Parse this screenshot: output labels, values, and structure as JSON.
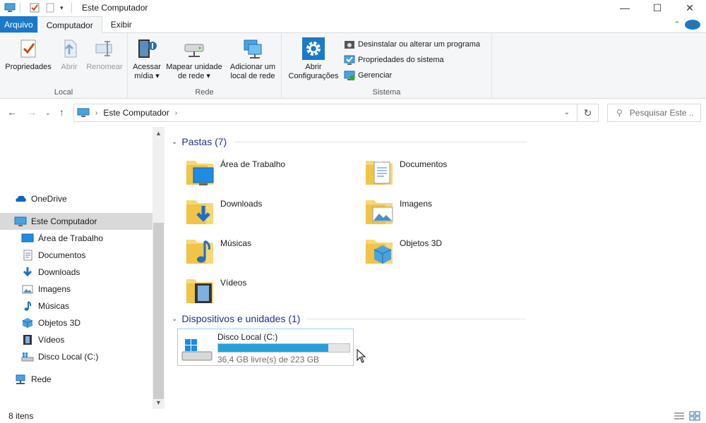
{
  "window": {
    "title": "Este Computador",
    "min_glyph": "—",
    "max_glyph": "☐",
    "close_glyph": "✕"
  },
  "tabs": {
    "file": "Arquivo",
    "computer": "Computador",
    "view": "Exibir"
  },
  "ribbon": {
    "groups": {
      "local": "Local",
      "network": "Rede",
      "system": "Sistema"
    },
    "properties": "Propriedades",
    "open": "Abrir",
    "rename": "Renomear",
    "access_media_1": "Acessar",
    "access_media_2": "mídia ▾",
    "map_drive_1": "Mapear unidade",
    "map_drive_2": "de rede ▾",
    "add_location_1": "Adicionar um",
    "add_location_2": "local de rede",
    "open_settings_1": "Abrir",
    "open_settings_2": "Configurações",
    "uninstall": "Desinstalar ou alterar um programa",
    "system_properties": "Propriedades do sistema",
    "manage": "Gerenciar"
  },
  "address": {
    "crumb": "Este Computador",
    "search_placeholder": "Pesquisar Este ..."
  },
  "sidebar": {
    "items": [
      {
        "label": "OneDrive"
      },
      {
        "label": "Este Computador"
      },
      {
        "label": "Área de Trabalho"
      },
      {
        "label": "Documentos"
      },
      {
        "label": "Downloads"
      },
      {
        "label": "Imagens"
      },
      {
        "label": "Músicas"
      },
      {
        "label": "Objetos 3D"
      },
      {
        "label": "Vídeos"
      },
      {
        "label": "Disco Local (C:)"
      },
      {
        "label": "Rede"
      }
    ]
  },
  "main": {
    "folders_header": "Pastas (7)",
    "devices_header": "Dispositivos e unidades (1)",
    "folders": [
      {
        "label": "Área de Trabalho"
      },
      {
        "label": "Documentos"
      },
      {
        "label": "Downloads"
      },
      {
        "label": "Imagens"
      },
      {
        "label": "Músicas"
      },
      {
        "label": "Objetos 3D"
      },
      {
        "label": "Vídeos"
      }
    ],
    "drive": {
      "name": "Disco Local (C:)",
      "free_text": "36,4 GB livre(s) de 223 GB",
      "used_fraction": 0.837
    }
  },
  "status": {
    "count": "8 itens"
  },
  "colors": {
    "accent": "#1979ca",
    "bar_fill": "#26a0da",
    "folder": "#f8d775",
    "section_text": "#1e3287"
  }
}
